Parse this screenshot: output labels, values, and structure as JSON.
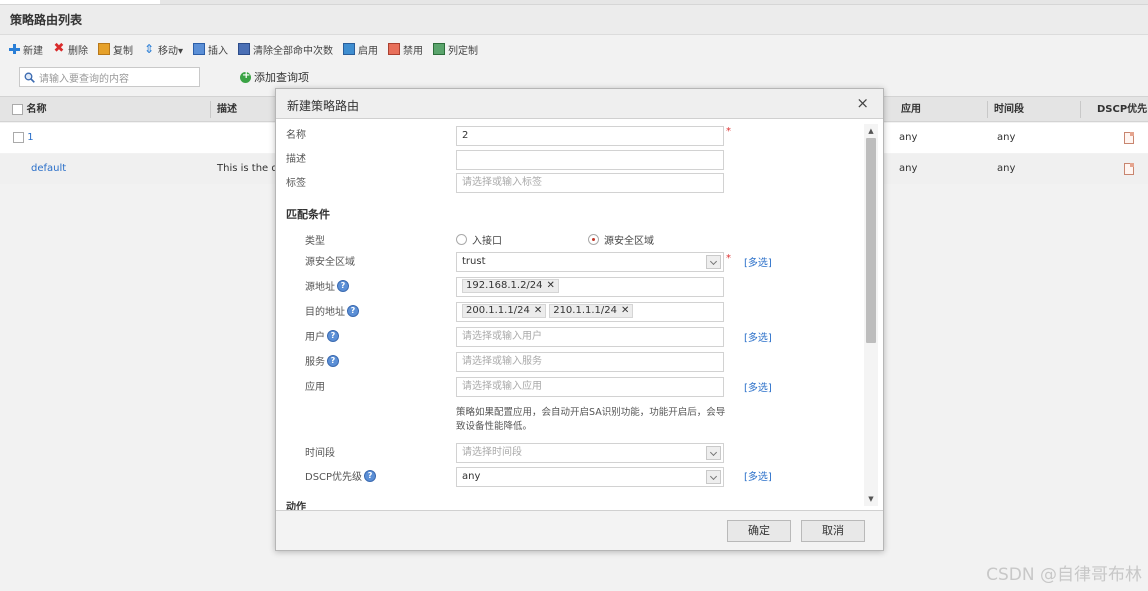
{
  "page": {
    "title": "策略路由列表",
    "watermark": "CSDN @自律哥布林"
  },
  "toolbar": {
    "new": "新建",
    "delete": "删除",
    "copy": "复制",
    "move": "移动▾",
    "insert": "插入",
    "clear_hits": "清除全部命中次数",
    "enable": "启用",
    "disable": "禁用",
    "columns": "列定制"
  },
  "search": {
    "placeholder": "请输入要查询的内容",
    "add_query": "添加查询项"
  },
  "grid": {
    "headers": {
      "name": "名称",
      "desc": "描述",
      "app": "应用",
      "time": "时间段",
      "dscp": "DSCP优先"
    },
    "rows": [
      {
        "name": "1",
        "desc": "",
        "app": "any",
        "time": "any"
      },
      {
        "name": "default",
        "desc": "This is the d",
        "app": "any",
        "time": "any"
      }
    ]
  },
  "dialog": {
    "title": "新建策略路由",
    "close": "×",
    "name_label": "名称",
    "name_value": "2",
    "required_mark": "*",
    "desc_label": "描述",
    "desc_value": "",
    "tag_label": "标签",
    "tag_placeholder": "请选择或输入标签",
    "match_section": "匹配条件",
    "type_label": "类型",
    "type_option_in": "入接口",
    "type_option_zone": "源安全区域",
    "src_zone_label": "源安全区域",
    "src_zone_value": "trust",
    "more": "[多选]",
    "src_addr_label": "源地址",
    "src_addr_tags": [
      "192.168.1.2/24"
    ],
    "dst_addr_label": "目的地址",
    "dst_addr_tags": [
      "200.1.1.1/24",
      "210.1.1.1/24"
    ],
    "tag_remove": "✕",
    "help_icon": "?",
    "user_label": "用户",
    "user_placeholder": "请选择或输入用户",
    "service_label": "服务",
    "service_placeholder": "请选择或输入服务",
    "app_label": "应用",
    "app_placeholder": "请选择或输入应用",
    "app_note": "策略如果配置应用，会自动开启SA识别功能，功能开启后，会导致设备性能降低。",
    "time_label": "时间段",
    "time_placeholder": "请选择时间段",
    "dscp_label": "DSCP优先级",
    "dscp_value": "any",
    "action_section": "动作",
    "ok": "确定",
    "cancel": "取消"
  }
}
